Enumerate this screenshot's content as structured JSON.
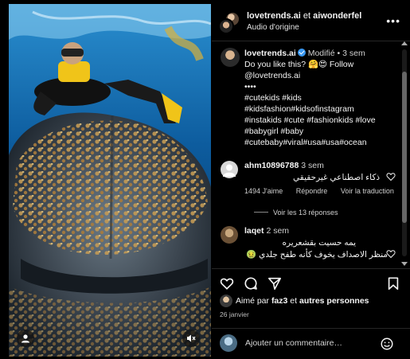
{
  "header": {
    "user1": "lovetrends.ai",
    "conjunction": "et",
    "user2": "aiwonderfel",
    "audio": "Audio d'origine",
    "more": "•••"
  },
  "caption": {
    "user": "lovetrends.ai",
    "modified": "Modifié",
    "separator": "•",
    "time": "3 sem",
    "line1": "Do you like this? 🤗😍 Follow",
    "line2": "@lovetrends.ai",
    "line3": "••••",
    "tags": [
      "#cutekids #kids",
      "#kidsfashion#kidsofinstagram",
      "#instakids #cute #fashionkids #love",
      "#babygirl #baby",
      "#cutebaby#viral#usa#usa#ocean"
    ]
  },
  "comments": [
    {
      "user": "ahm10896788",
      "time": "3 sem",
      "text": "ذكاء اصطناعي غيرحقيقي",
      "likes": "1494 J'aime",
      "reply": "Répondre",
      "translate": "Voir la traduction",
      "view_replies": "Voir les 13 réponses"
    },
    {
      "user": "laqet",
      "time": "2 sem",
      "text_line1": "يمه حسيت بقشعريره",
      "text_line2": "منظر الاصداف يخوف كأنه طفح جلدي 🤢"
    }
  ],
  "likes": {
    "prefix": "Aimé par",
    "user": "faz3",
    "middle": "et",
    "others": "autres personnes"
  },
  "date": "26 janvier",
  "add_comment": {
    "placeholder": "Ajouter un commentaire…"
  },
  "icons": {
    "like": "heart-icon",
    "comment": "comment-icon",
    "share": "send-icon",
    "save": "bookmark-icon",
    "emoji": "emoji-icon",
    "mute": "muted-speaker-icon",
    "user_tag": "user-icon"
  },
  "colors": {
    "background": "#000000",
    "verified": "#3897f0",
    "divider": "#262626"
  }
}
